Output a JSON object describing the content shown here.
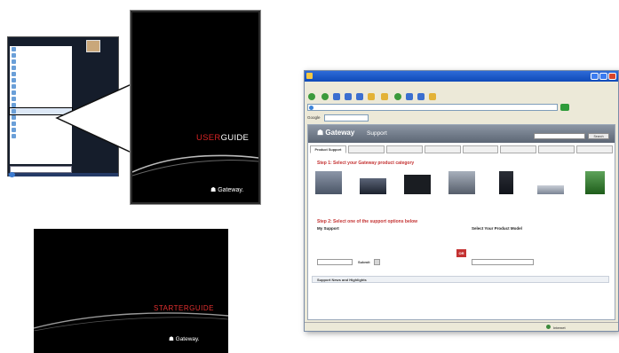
{
  "start_menu": {
    "programs": [
      "",
      "",
      "",
      "",
      "",
      "",
      "",
      "",
      "",
      "",
      "",
      "",
      "",
      "",
      "",
      ""
    ],
    "highlighted_index": 10,
    "right_links": [
      "",
      "",
      "",
      "",
      "",
      "",
      "",
      "",
      "",
      "",
      "",
      ""
    ],
    "back_label": "",
    "search_placeholder": ""
  },
  "user_guide": {
    "title_part1": "USER",
    "title_part2": "GUIDE",
    "brand": "Gateway."
  },
  "starter_guide": {
    "title": "STARTERGUIDE",
    "brand": "Gateway."
  },
  "browser": {
    "title": "",
    "menus": [
      "",
      "",
      "",
      "",
      "",
      ""
    ],
    "toolbar": {
      "back": "",
      "search": "",
      "favorites": ""
    },
    "address": "",
    "google_label": "Google",
    "page": {
      "logo": "Gateway",
      "section": "Support",
      "search_button": "Search",
      "tabs": [
        "Product Support",
        "",
        "",
        "",
        "",
        "",
        "",
        ""
      ],
      "step1": "Step 1: Select your Gateway product category",
      "step1_link": "",
      "products": [
        "",
        "",
        "",
        "",
        "",
        "",
        "",
        ""
      ],
      "step2": "Step 2: Select one of the support options below",
      "my_support_title": "My Support",
      "my_support_text": "",
      "serial_label": "",
      "submit": "Submit",
      "serial_note": "",
      "or": "OR",
      "product_guide_title": "Select Your Product Model",
      "product_guide_text": "",
      "product_select": "",
      "news_bar": "Support News and Highlights",
      "news_link": ""
    },
    "status": "Internet"
  }
}
